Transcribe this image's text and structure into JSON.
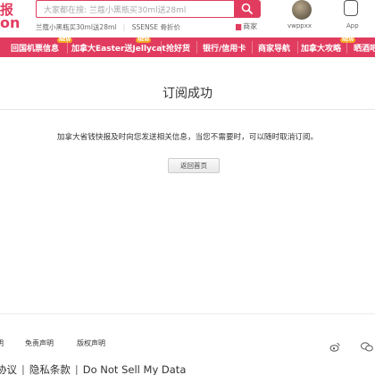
{
  "header": {
    "logo_top": "报",
    "logo_bottom": "on",
    "search_placeholder": "大家都在搜: 兰蔻小黑瓶买30ml送28ml",
    "hot_links": [
      "兰蔻小黑瓶买30ml送28ml",
      "SSENSE 骨折价"
    ],
    "merchant_label": "商家",
    "username": "vwppxx",
    "app_label": "App"
  },
  "nav": {
    "items": [
      {
        "label": "回国机票信息",
        "badge": "NEW"
      },
      {
        "label": "加拿大Easter送Jellycat",
        "badge": "NEW"
      },
      {
        "label": "抢好货",
        "badge": ""
      },
      {
        "label": "银行/信用卡",
        "badge": ""
      },
      {
        "label": "商家导航",
        "badge": ""
      },
      {
        "label": "加拿大攻略",
        "badge": "NEW"
      },
      {
        "label": "晒酒吧",
        "badge": ""
      }
    ]
  },
  "main": {
    "title": "订阅成功",
    "message": "加拿大省钱快报及时向您发送相关信息，当您不需要时，可以随时取消订阅。",
    "home_button": "返回首页"
  },
  "footer": {
    "links": [
      "明",
      "免责声明",
      "版权声明"
    ],
    "legal": [
      "协议",
      "隐私条款",
      "Do Not Sell My Data"
    ]
  },
  "colors": {
    "brand": "#e13c5f",
    "badge": "#f5a623"
  }
}
